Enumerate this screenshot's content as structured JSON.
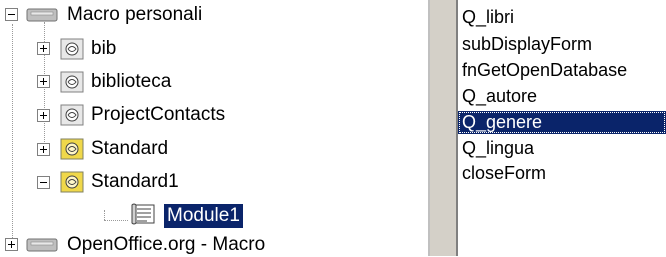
{
  "tree": {
    "items": [
      {
        "label": "Macro personali",
        "icon": "library-container-icon",
        "expander": "minus"
      },
      {
        "label": "bib",
        "icon": "library-icon",
        "expander": "plus"
      },
      {
        "label": "biblioteca",
        "icon": "library-icon",
        "expander": "plus"
      },
      {
        "label": "ProjectContacts",
        "icon": "library-icon",
        "expander": "plus"
      },
      {
        "label": "Standard",
        "icon": "library-icon-yellow",
        "expander": "plus"
      },
      {
        "label": "Standard1",
        "icon": "library-icon-yellow",
        "expander": "minus"
      },
      {
        "label": "Module1",
        "icon": "module-icon",
        "expander": "none",
        "selected": true
      },
      {
        "label": "OpenOffice.org - Macro",
        "icon": "library-container-icon",
        "expander": "plus"
      }
    ]
  },
  "macro_list": {
    "items": [
      "Q_libri",
      "subDisplayForm",
      "fnGetOpenDatabase",
      "Q_autore",
      "Q_genere",
      "Q_lingua",
      "closeForm"
    ],
    "selected": "Q_genere"
  },
  "colors": {
    "selection": "#0a246a",
    "folder_yellow": "#f0d84a",
    "container_gray": "#bfbfbf"
  }
}
